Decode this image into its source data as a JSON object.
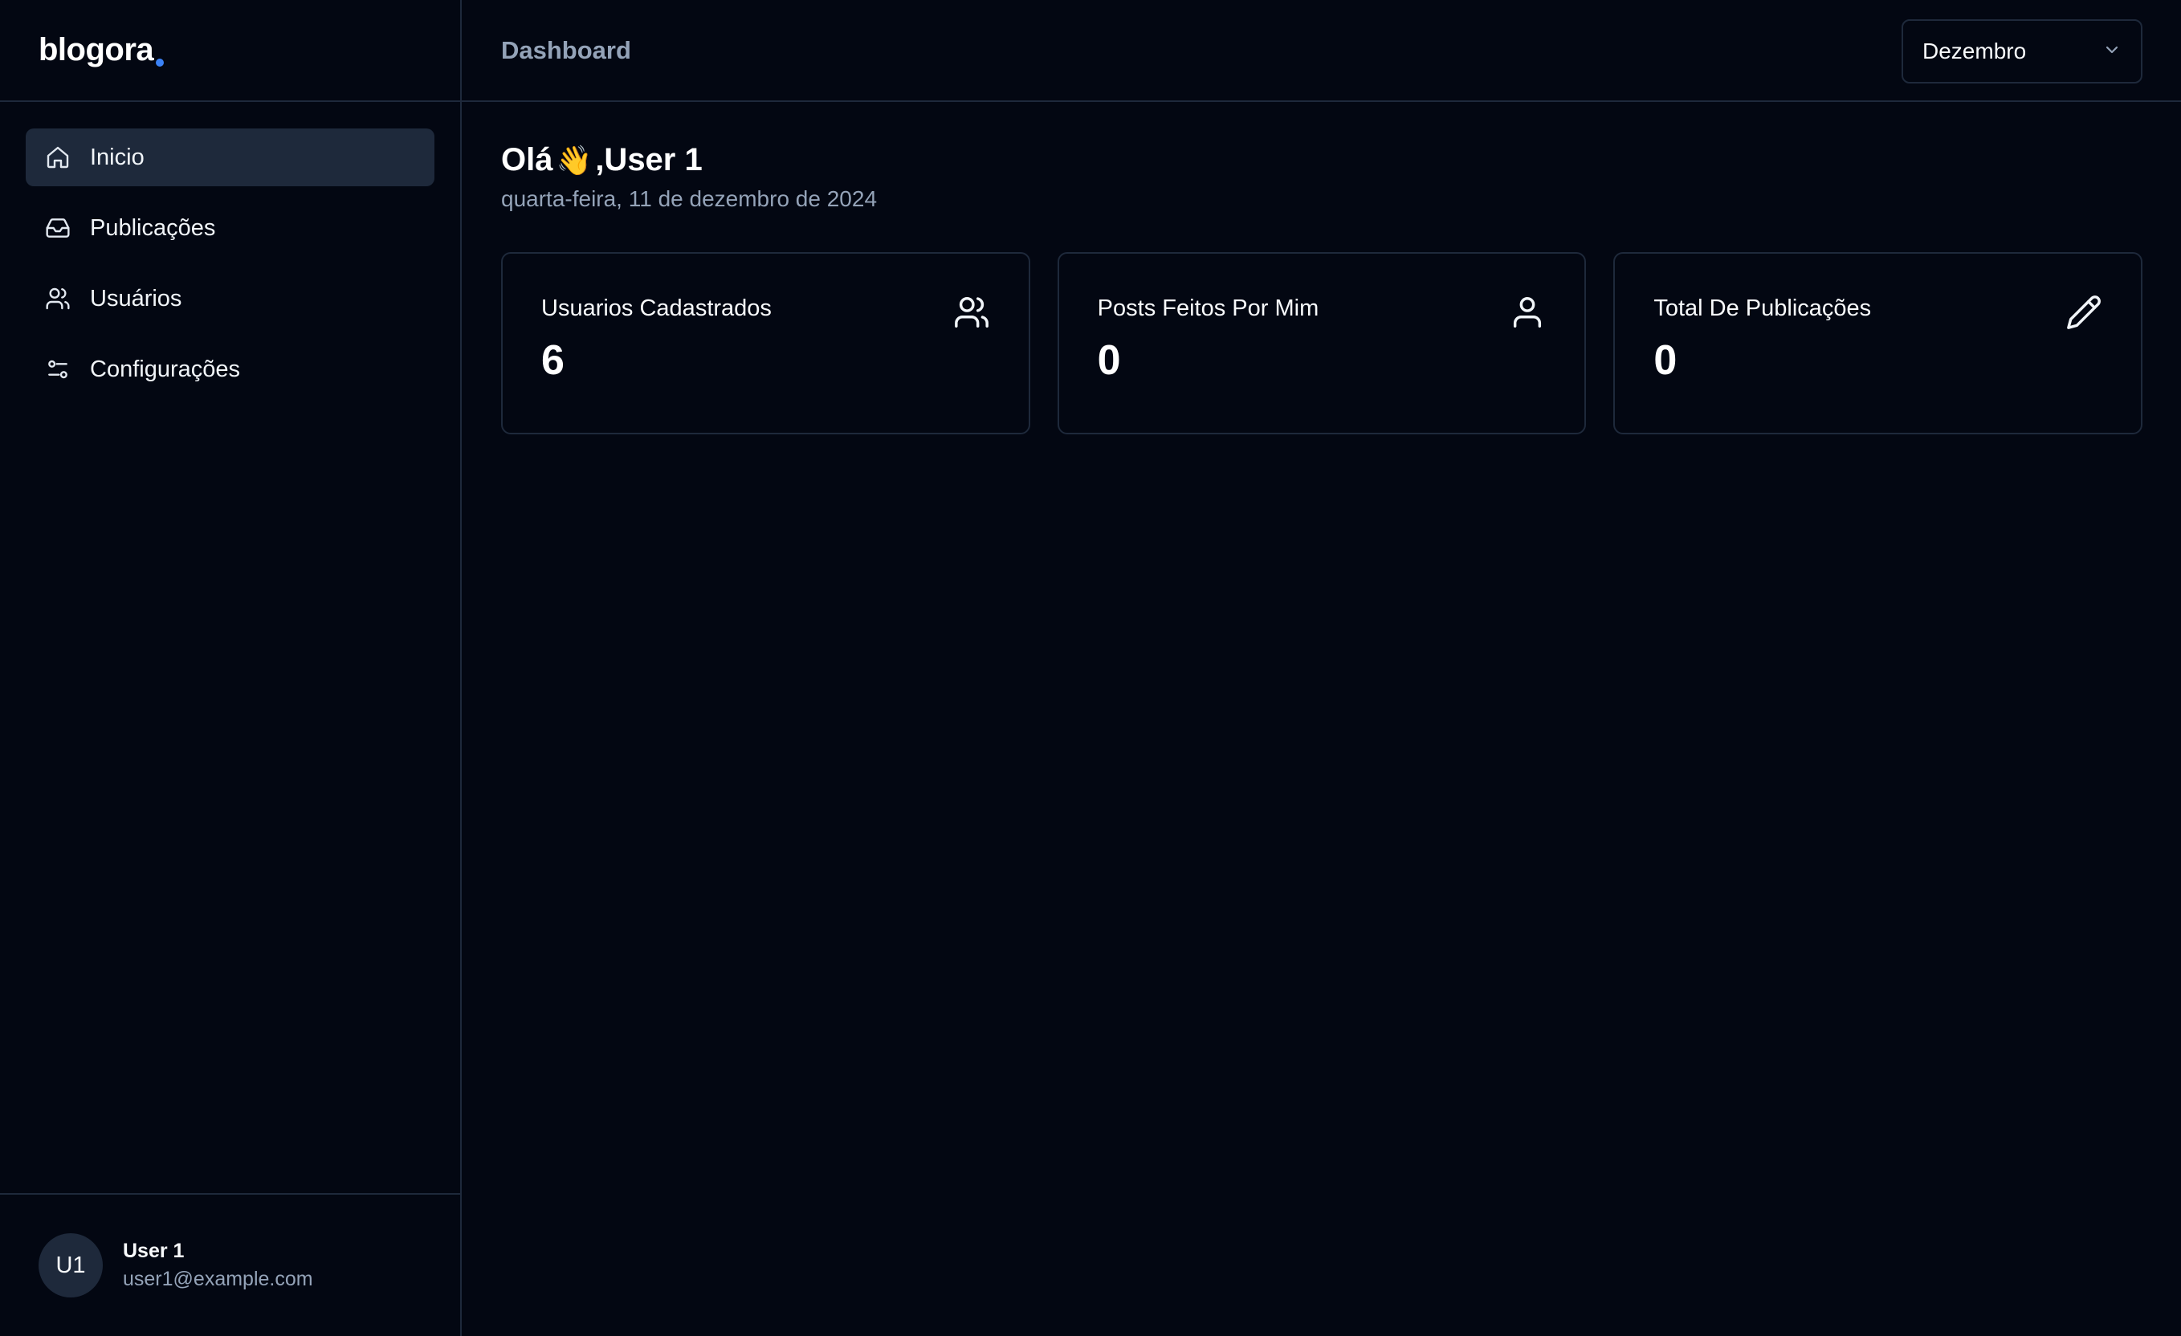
{
  "brand": {
    "logo_text": "blogora",
    "accent_color": "#3b82f6"
  },
  "sidebar": {
    "items": [
      {
        "label": "Inicio",
        "icon": "home-icon",
        "active": true
      },
      {
        "label": "Publicações",
        "icon": "inbox-icon",
        "active": false
      },
      {
        "label": "Usuários",
        "icon": "users-icon",
        "active": false
      },
      {
        "label": "Configurações",
        "icon": "sliders-icon",
        "active": false
      }
    ],
    "user": {
      "initials": "U1",
      "name": "User 1",
      "email": "user1@example.com"
    }
  },
  "header": {
    "title": "Dashboard",
    "month_select": {
      "value": "Dezembro"
    }
  },
  "main": {
    "greeting_prefix": "Olá",
    "greeting_emoji": "👋",
    "greeting_suffix": ",User 1",
    "date": "quarta-feira, 11 de dezembro de 2024",
    "cards": [
      {
        "title": "Usuarios Cadastrados",
        "value": "6",
        "icon": "users-icon"
      },
      {
        "title": "Posts Feitos Por Mim",
        "value": "0",
        "icon": "user-icon"
      },
      {
        "title": "Total De Publicações",
        "value": "0",
        "icon": "pencil-icon"
      }
    ]
  },
  "colors": {
    "background": "#030712",
    "border": "#1e293b",
    "muted_text": "#94a3b8",
    "active_nav_bg": "#1e293b"
  }
}
